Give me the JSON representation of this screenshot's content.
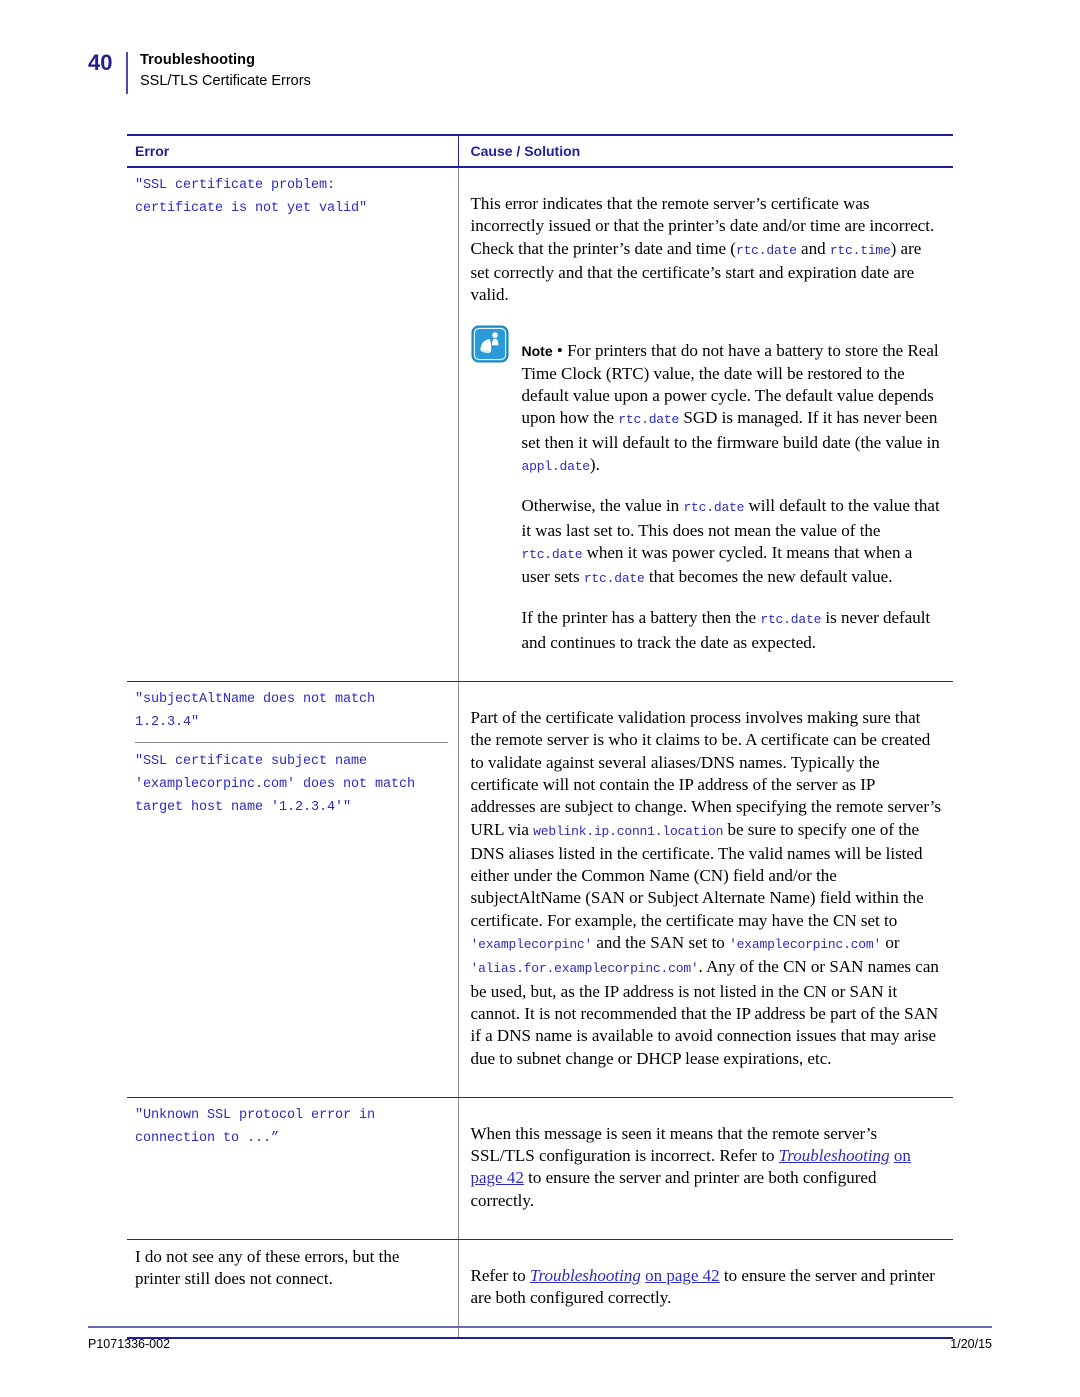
{
  "header": {
    "page_number": "40",
    "chapter_title": "Troubleshooting",
    "section_title": "SSL/TLS Certificate Errors"
  },
  "table": {
    "columns": {
      "error": "Error",
      "cause_label": "Cause",
      "cause_separator": " / ",
      "solution_label": "Solution"
    },
    "rows": [
      {
        "errors": [
          "\"SSL certificate problem:\ncertificate is not yet valid\""
        ],
        "cause": {
          "paragraph_1": {
            "part_1": "This error indicates that the remote server’s certificate was incorrectly issued or that the printer’s date and/or time are incorrect. Check that the printer’s date and time (",
            "code_1": "rtc.date",
            "part_2": " and ",
            "code_2": "rtc.time",
            "part_3": ") are set correctly and that the certificate’s start and expiration date are valid."
          },
          "note": {
            "icon": "note-icon",
            "lead": "Note",
            "bullet": " • ",
            "paragraph_1": {
              "part_1": "For printers that do not have a battery to store the Real Time Clock (RTC) value, the date will be restored to the default value upon a power cycle. The default value depends upon how the ",
              "code_1": "rtc.date",
              "part_2": " SGD is managed. If it has never been set then it will default to the firmware build date (the value in ",
              "code_2": "appl.date",
              "part_3": ")."
            },
            "paragraph_2": {
              "part_1": "Otherwise, the value in ",
              "code_1": "rtc.date",
              "part_2": " will default to the value that it was last set to. This does not mean the value of the ",
              "code_2": "rtc.date",
              "part_3": " when it was power cycled. It means that when a user sets ",
              "code_3": "rtc.date",
              "part_4": " that becomes the new default value."
            },
            "paragraph_3": {
              "part_1": "If the printer has a battery then the ",
              "code_1": "rtc.date",
              "part_2": " is never default and continues to track the date as expected."
            }
          }
        }
      },
      {
        "errors": [
          "\"subjectAltName does not match\n1.2.3.4\"",
          "\"SSL certificate subject name\n'examplecorpinc.com' does not match\ntarget host name '1.2.3.4'\""
        ],
        "cause": {
          "paragraph_1": {
            "part_1": "Part of the certificate validation process involves making sure that the remote server is who it claims to be. A certificate can be created to validate against several aliases/DNS names. Typically the certificate will not contain the IP address of the server as IP addresses are subject to change. When specifying the remote server’s URL via ",
            "code_1": "weblink.ip.conn1.location",
            "part_2": " be sure to specify one of the DNS aliases listed in the certificate. The valid names will be listed either under the Common Name (CN) field and/or the subjectAltName (SAN or Subject Alternate Name) field within the certificate. For example, the certificate may have the CN set to ",
            "code_2": "'examplecorpinc'",
            "part_3": " and the SAN set to ",
            "code_3": "'examplecorpinc.com'",
            "part_4": " or ",
            "code_4": "'alias.for.examplecorpinc.com'",
            "part_5": ". Any of the CN or SAN names can be used, but, as the IP address is not listed in the CN or SAN it cannot. It is not recommended that the IP address be part of the SAN if a DNS name is available to avoid connection issues that may arise due to subnet change or DHCP lease expirations, etc."
          }
        }
      },
      {
        "errors": [
          "\"Unknown SSL protocol error in\nconnection to ...”"
        ],
        "cause": {
          "paragraph_1": {
            "part_1": "When this message is seen it means that the remote server’s SSL/TLS configuration is incorrect. Refer to ",
            "xref_italic": "Troubleshooting",
            "part_2": " ",
            "xref_plain": "on page 42",
            "part_3": " to ensure the server and printer are both configured correctly."
          }
        }
      },
      {
        "errors_plain": [
          "I do not see any of these errors, but the printer still does not connect."
        ],
        "cause": {
          "paragraph_1": {
            "part_1": "Refer to ",
            "xref_italic": "Troubleshooting",
            "part_2": " ",
            "xref_plain": "on page 42",
            "part_3": " to ensure the server and printer are both configured correctly."
          }
        }
      }
    ]
  },
  "footer": {
    "document_number": "P1071336-002",
    "date": "1/20/15"
  },
  "colors": {
    "accent_blue": "#1f1f9e",
    "code_blue": "#2b2bc4",
    "note_icon_blue": "#2a9bd8",
    "rule_gray": "#8a8a9c"
  }
}
